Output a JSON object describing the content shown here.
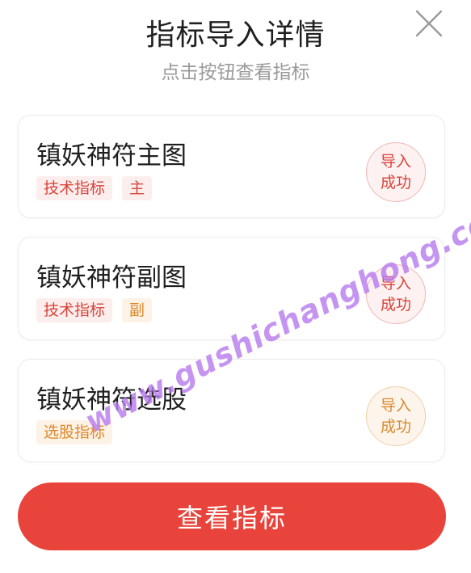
{
  "header": {
    "title": "指标导入详情",
    "subtitle": "点击按钮查看指标",
    "close_icon": "close-icon"
  },
  "cards": [
    {
      "name": "镇妖神符主图",
      "tags": [
        {
          "label": "技术指标",
          "color": "#d8453b"
        },
        {
          "label": "主",
          "color": "#d8453b"
        }
      ],
      "status_line1": "导入",
      "status_line2": "成功",
      "status_color": "#d8453b"
    },
    {
      "name": "镇妖神符副图",
      "tags": [
        {
          "label": "技术指标",
          "color": "#d8453b"
        },
        {
          "label": "副",
          "color": "#e0882a"
        }
      ],
      "status_line1": "导入",
      "status_line2": "成功",
      "status_color": "#d8453b"
    },
    {
      "name": "镇妖神符选股",
      "tags": [
        {
          "label": "选股指标",
          "color": "#e0882a"
        }
      ],
      "status_line1": "导入",
      "status_line2": "成功",
      "status_color": "#d98a2e"
    }
  ],
  "footer": {
    "button_label": "查看指标",
    "button_color": "#e8443b"
  },
  "watermark": "www.gushichanghong.com"
}
